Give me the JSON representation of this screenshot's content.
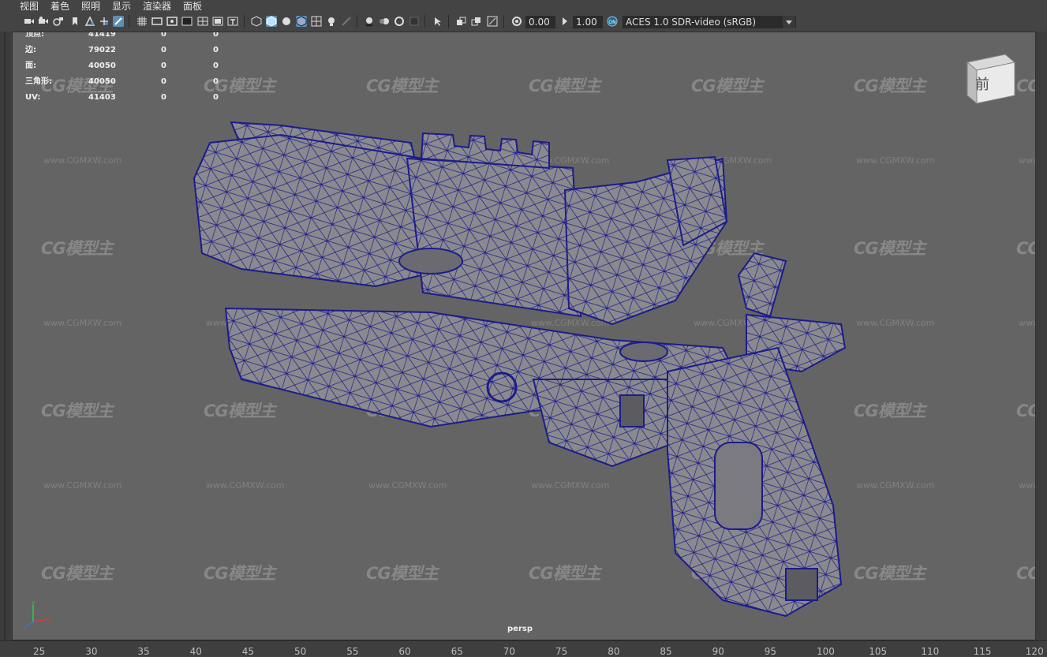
{
  "menu": {
    "view": "视图",
    "shading": "着色",
    "lighting": "照明",
    "show": "显示",
    "renderer": "渲染器",
    "panels": "面板"
  },
  "toolbar": {
    "exposure_value": "0.00",
    "gamma_value": "1.00",
    "color_space": "ACES 1.0 SDR-video (sRGB)",
    "icons": [
      "camera-icon",
      "camera-attr-icon",
      "bookmark-icon",
      "image-plane-icon",
      "grid-toggle-icon",
      "film-gate-icon",
      "resolution-gate-icon",
      "gate-mask-icon",
      "field-chart-icon",
      "safe-action-icon",
      "safe-title-icon",
      "wireframe-icon",
      "smooth-shade-icon",
      "default-material-icon",
      "wireframe-on-shaded-icon",
      "xray-icon",
      "textured-icon",
      "lights-icon",
      "shadows-icon",
      "ambient-occlusion-icon",
      "motion-blur-icon",
      "anti-aliasing-icon",
      "depth-of-field-icon",
      "isolate-select-icon",
      "xray-active-icon",
      "xray-joints-icon",
      "backface-cull-icon",
      "exposure-icon",
      "gamma-icon",
      "color-management-icon"
    ]
  },
  "hud": {
    "rows": [
      {
        "label": "顶点:",
        "v1": "41419",
        "v2": "0",
        "v3": "0"
      },
      {
        "label": "边:",
        "v1": "79022",
        "v2": "0",
        "v3": "0"
      },
      {
        "label": "面:",
        "v1": "40050",
        "v2": "0",
        "v3": "0"
      },
      {
        "label": "三角形:",
        "v1": "40050",
        "v2": "0",
        "v3": "0"
      },
      {
        "label": "UV:",
        "v1": "41403",
        "v2": "0",
        "v3": "0"
      }
    ]
  },
  "viewport": {
    "camera_name": "persp",
    "viewcube_face": "前",
    "watermark_text": "CG模型主",
    "watermark_url": "www.CGMXW.com"
  },
  "timeline": {
    "ticks": [
      "25",
      "30",
      "35",
      "40",
      "45",
      "50",
      "55",
      "60",
      "65",
      "70",
      "75",
      "80",
      "85",
      "90",
      "95",
      "100",
      "105",
      "110",
      "115",
      "120"
    ]
  },
  "colors": {
    "viewport_bg": "#646464",
    "wire": "#1c1c8c",
    "mesh_fill": "#8a8a8e",
    "active_icon": "#5d8fb7"
  }
}
